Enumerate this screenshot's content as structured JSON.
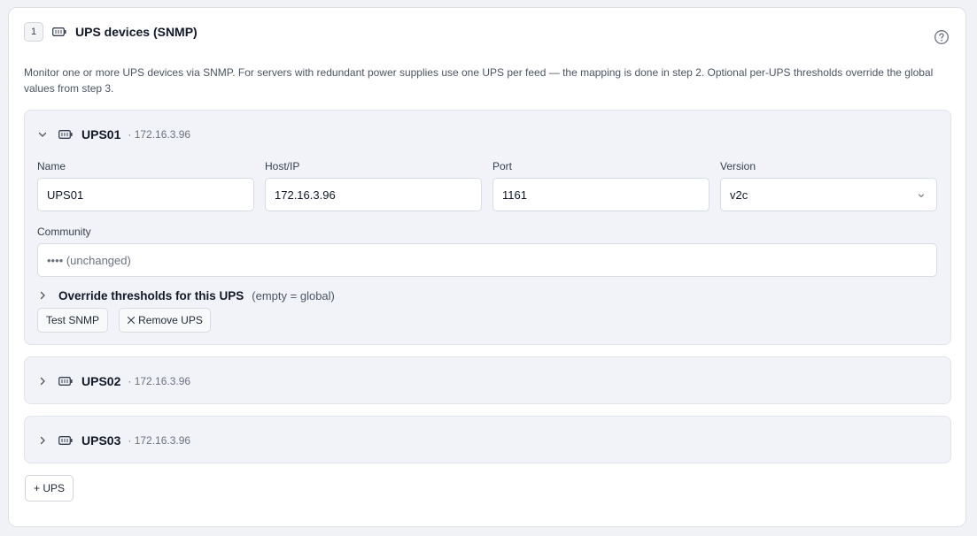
{
  "header": {
    "step": "1",
    "title": "UPS devices (SNMP)",
    "description": "Monitor one or more UPS devices via SNMP. For servers with redundant power supplies use one UPS per feed — the mapping is done in step 2. Optional per-UPS thresholds override the global values from step 3."
  },
  "ups_list": [
    {
      "name": "UPS01",
      "ip": "· 172.16.3.96",
      "expanded": true,
      "fields": {
        "name_label": "Name",
        "name_value": "UPS01",
        "host_label": "Host/IP",
        "host_value": "172.16.3.96",
        "port_label": "Port",
        "port_value": "1161",
        "version_label": "Version",
        "version_value": "v2c",
        "community_label": "Community",
        "community_placeholder": "•••• (unchanged)"
      },
      "override": {
        "title": "Override thresholds for this UPS",
        "note": "(empty = global)"
      },
      "buttons": {
        "test": "Test SNMP",
        "remove": "Remove UPS"
      }
    },
    {
      "name": "UPS02",
      "ip": "· 172.16.3.96",
      "expanded": false
    },
    {
      "name": "UPS03",
      "ip": "· 172.16.3.96",
      "expanded": false
    }
  ],
  "add_button": "+ UPS",
  "icons": {
    "step": "ups-battery-icon",
    "help": "help-circle-icon",
    "collapse": "chevron-down-icon",
    "expand": "chevron-right-icon",
    "remove": "close-icon",
    "select": "chevron-down-icon"
  },
  "colors": {
    "panel_bg": "#f1f3f8",
    "border": "#dfe3ea",
    "text": "#111827",
    "muted": "#6b7280"
  }
}
